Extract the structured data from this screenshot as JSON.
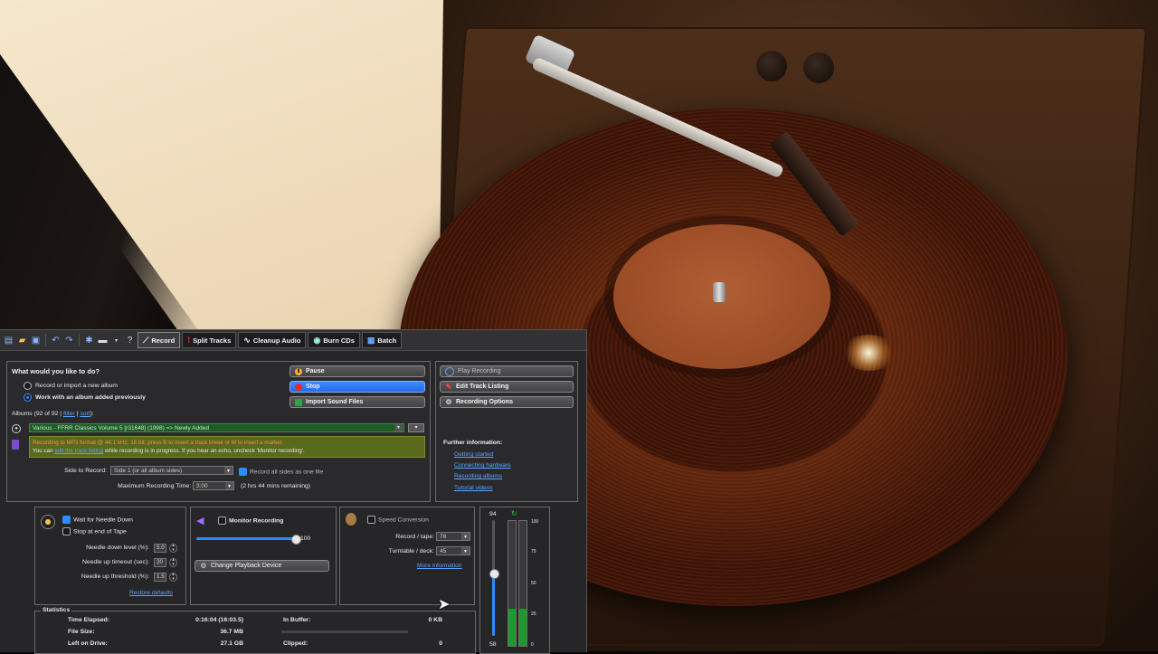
{
  "toolbar": {
    "tabs": [
      {
        "label": "Record",
        "icon": "wand-icon"
      },
      {
        "label": "Split Tracks",
        "icon": "split-icon"
      },
      {
        "label": "Cleanup Audio",
        "icon": "waveform-icon"
      },
      {
        "label": "Burn CDs",
        "icon": "cd-icon"
      },
      {
        "label": "Batch",
        "icon": "batch-icon"
      }
    ]
  },
  "main": {
    "question": "What would you like to do?",
    "option_new": "Record or import a new album",
    "option_existing": "Work with an album added previously",
    "albums_label": "Albums (92 of 92 |",
    "albums_filter": "filter",
    "albums_sep": "|",
    "albums_sort": "sort",
    "albums_end": "):",
    "album_selected": "Various - FFRR Classics Volume 5 [r31648] (1998) => Newly Added",
    "note_line1": "Recording to MP3 format @ 44.1 kHz, 16 bit; press B to insert a track break or M to insert a marker.",
    "note_line2_pre": "You can",
    "note_line2_link": "edit the track listing",
    "note_line2_post": "while recording is in progress.  If you hear an echo, uncheck 'Monitor recording'.",
    "side_label": "Side to Record:",
    "side_value": "Side 1 (or all album sides)",
    "record_all_sides": "Record all sides as one file",
    "max_time_label": "Maximum Recording Time:",
    "max_time_value": "3:00",
    "remaining": "(2 hrs 44 mins remaining)"
  },
  "actions": {
    "pause": "Pause",
    "stop": "Stop",
    "import": "Import Sound Files"
  },
  "side": {
    "play": "Play Recording",
    "edit": "Edit Track Listing",
    "options": "Recording Options",
    "further": "Further information:",
    "links": [
      "Getting started",
      "Connecting hardware",
      "Recording albums",
      "Tutorial videos"
    ]
  },
  "needle": {
    "wait": "Wait for Needle Down",
    "stop_end": "Stop at end of Tape",
    "down_label": "Needle down level (%):",
    "down_value": "5.0",
    "timeout_label": "Needle up timeout (sec):",
    "timeout_value": "20",
    "threshold_label": "Needle up threshold (%):",
    "threshold_value": "1.5",
    "restore": "Restore defaults"
  },
  "monitor": {
    "label": "Monitor Recording",
    "volume": "100",
    "volume_fraction": 1.0,
    "change_device": "Change Playback Device"
  },
  "speed": {
    "label": "Speed Conversion",
    "record_label": "Record / tape:",
    "record_value": "78",
    "turntable_label": "Turntable / deck:",
    "turntable_value": "45",
    "more": "More information"
  },
  "meter": {
    "top": "94",
    "bottom": "58",
    "slider_fraction": 0.55,
    "scale": [
      "100",
      "75",
      "50",
      "25",
      "0"
    ],
    "left_level": 0.3,
    "right_level": 0.3
  },
  "stats": {
    "title": "Statistics",
    "elapsed_label": "Time Elapsed:",
    "elapsed_value": "0:16:04 (16:03.5)",
    "size_label": "File Size:",
    "size_value": "36.7 MB",
    "drive_label": "Left on Drive:",
    "drive_value": "27.1 GB",
    "buffer_label": "In Buffer:",
    "buffer_value": "0 KB",
    "clipped_label": "Clipped:",
    "clipped_value": "0"
  }
}
